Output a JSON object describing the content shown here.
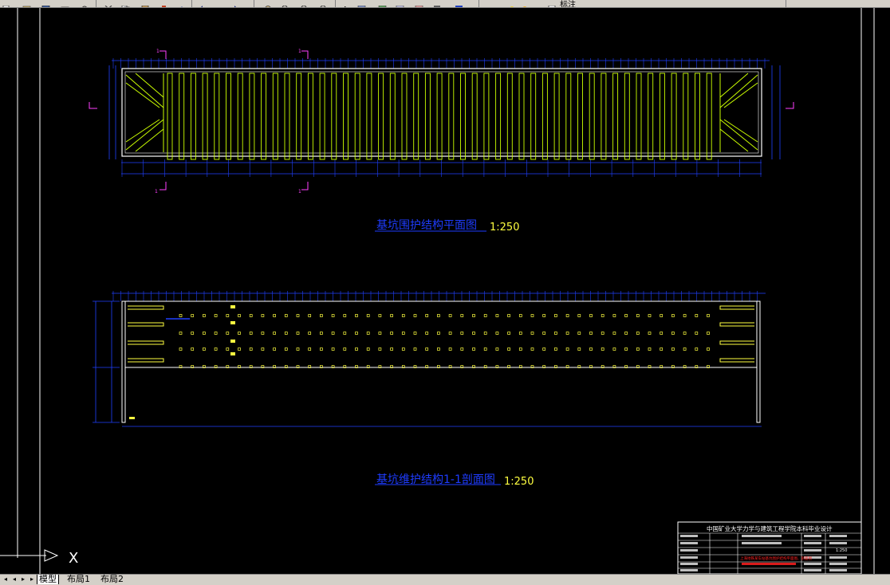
{
  "toolbar": {
    "layer_label": "标注",
    "buttons": [
      "new-icon",
      "open-icon",
      "save-icon",
      "print-icon",
      "cut-icon",
      "copy-icon",
      "paste-icon",
      "undo-icon",
      "redo-icon",
      "pan-icon",
      "zoom-icon",
      "zoom-window-icon",
      "zoom-previous-icon",
      "properties-icon",
      "design-center-icon",
      "tool-palette-icon",
      "calculator-icon",
      "layer-icon",
      "match-icon"
    ]
  },
  "drawing": {
    "plan_title": "基坑围护结构平面图",
    "plan_scale": "1:250",
    "section_title": "基坑维护结构1-1剖面图",
    "section_scale": "1:250",
    "section_marker_top_left": "1",
    "section_marker_top_right": "1",
    "section_marker_bottom_left": "1",
    "section_marker_bottom_right": "1",
    "ucs_label": "X",
    "colors": {
      "frame": "#ffffff",
      "strut": "#ccff00",
      "dim": "#1e40ff",
      "title": "#1e3cff",
      "scale": "#ffff40",
      "marker": "#ff40ff",
      "red": "#ff2020"
    }
  },
  "title_block": {
    "header": "中国矿业大学力学与建筑工程学院本科毕业设计",
    "note": "上海地铁某车站基坑围护结构平面图、剖面图",
    "scale": "1:250"
  },
  "tabs": [
    {
      "label": "模型",
      "active": true
    },
    {
      "label": "布局1",
      "active": false
    },
    {
      "label": "布局2",
      "active": false
    }
  ]
}
